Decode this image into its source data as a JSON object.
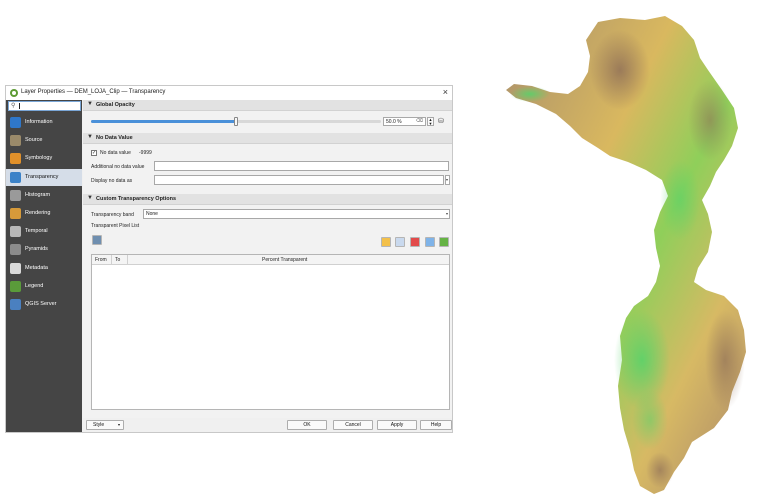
{
  "dialog": {
    "title": "Layer Properties — DEM_LOJA_Clip — Transparency",
    "close_glyph": "×"
  },
  "sidebar": {
    "search_icon": "search-icon",
    "items": [
      {
        "label": "Information",
        "icon": "information-icon",
        "color": "#2f77c9"
      },
      {
        "label": "Source",
        "icon": "source-icon",
        "color": "#9a8a6a"
      },
      {
        "label": "Symbology",
        "icon": "symbology-icon",
        "color": "#e0902a"
      },
      {
        "label": "Transparency",
        "icon": "transparency-icon",
        "color": "#3b82c8",
        "selected": true
      },
      {
        "label": "Histogram",
        "icon": "histogram-icon",
        "color": "#9a9a9a"
      },
      {
        "label": "Rendering",
        "icon": "rendering-icon",
        "color": "#d69a3a"
      },
      {
        "label": "Temporal",
        "icon": "temporal-icon",
        "color": "#b8b8b8"
      },
      {
        "label": "Pyramids",
        "icon": "pyramids-icon",
        "color": "#8c8c8c"
      },
      {
        "label": "Metadata",
        "icon": "metadata-icon",
        "color": "#d9d9d9"
      },
      {
        "label": "Legend",
        "icon": "legend-icon",
        "color": "#5a9b3a"
      },
      {
        "label": "QGIS Server",
        "icon": "qgis-server-icon",
        "color": "#4a80c0"
      }
    ]
  },
  "global_opacity": {
    "header": "Global Opacity",
    "value_text": "50.0 %",
    "value": 0.5
  },
  "no_data": {
    "header": "No Data Value",
    "checkbox_label": "No data value",
    "checkbox_checked": true,
    "value": "-9999",
    "additional_label": "Additional no data value",
    "additional_value": "",
    "display_label": "Display no data as",
    "display_value": ""
  },
  "custom_transparency": {
    "header": "Custom Transparency Options",
    "band_label": "Transparency band",
    "band_value": "None",
    "pixel_list_label": "Transparent Pixel List",
    "table_headers": [
      "From",
      "To",
      "Percent Transparent"
    ],
    "rows": []
  },
  "buttons": {
    "style": "Style",
    "ok": "OK",
    "cancel": "Cancel",
    "apply": "Apply",
    "help": "Help"
  }
}
